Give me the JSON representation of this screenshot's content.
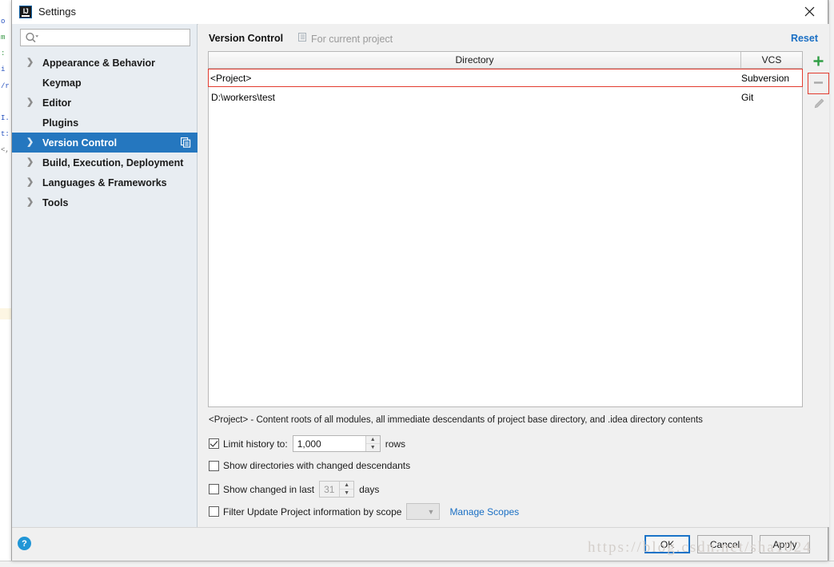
{
  "window": {
    "title": "Settings",
    "app_icon": "intellij-idea-icon",
    "close_label": "×"
  },
  "sidebar": {
    "search": {
      "value": "",
      "placeholder": "",
      "icon": "search-icon"
    },
    "items": [
      {
        "label": "Appearance & Behavior",
        "expandable": true,
        "selected": false
      },
      {
        "label": "Keymap",
        "expandable": false,
        "selected": false
      },
      {
        "label": "Editor",
        "expandable": true,
        "selected": false
      },
      {
        "label": "Plugins",
        "expandable": false,
        "selected": false
      },
      {
        "label": "Version Control",
        "expandable": true,
        "selected": true,
        "trailing_icon": "project-scope-icon"
      },
      {
        "label": "Build, Execution, Deployment",
        "expandable": true,
        "selected": false
      },
      {
        "label": "Languages & Frameworks",
        "expandable": true,
        "selected": false
      },
      {
        "label": "Tools",
        "expandable": true,
        "selected": false
      }
    ]
  },
  "main": {
    "title": "Version Control",
    "scope_note": "For current project",
    "scope_note_icon": "project-scope-icon",
    "reset_label": "Reset",
    "table": {
      "columns": [
        "Directory",
        "VCS"
      ],
      "rows": [
        {
          "directory": "<Project>",
          "vcs": "Subversion",
          "highlighted": true
        },
        {
          "directory": "D:\\workers\\test",
          "vcs": "Git",
          "highlighted": false
        }
      ]
    },
    "toolbar": [
      {
        "name": "add-button",
        "icon": "plus-icon",
        "highlighted": false
      },
      {
        "name": "remove-button",
        "icon": "minus-icon",
        "highlighted": true
      },
      {
        "name": "edit-button",
        "icon": "pencil-icon",
        "highlighted": false
      }
    ],
    "table_description": "<Project> - Content roots of all modules, all immediate descendants of project base directory, and .idea directory contents",
    "options": {
      "limit_history": {
        "label": "Limit history to:",
        "checked": true,
        "value": "1,000",
        "suffix": "rows"
      },
      "show_directories": {
        "label": "Show directories with changed descendants",
        "checked": false
      },
      "show_changed_in_last": {
        "label": "Show changed in last",
        "checked": false,
        "value": "31",
        "suffix": "days"
      },
      "filter_by_scope": {
        "label": "Filter Update Project information by scope",
        "checked": false,
        "select_value": "",
        "manage_link": "Manage Scopes"
      }
    }
  },
  "footer": {
    "help_label": "?",
    "ok_label": "OK",
    "cancel_label": "Cancel",
    "apply_label": "Apply"
  },
  "watermark": "https://blog.csdn.net/sha1024",
  "ide_background": {
    "code_fragments": [
      "o",
      "m",
      ":",
      "i",
      "/r",
      "I.",
      "t:",
      "<,"
    ]
  },
  "colors": {
    "selection_blue": "#2577bf",
    "link_blue": "#1a6fc4",
    "highlight_red": "#e23b2e",
    "add_green": "#2f9e44",
    "sidebar_bg": "#e8edf2",
    "dialog_bg": "#f0f0f0"
  }
}
